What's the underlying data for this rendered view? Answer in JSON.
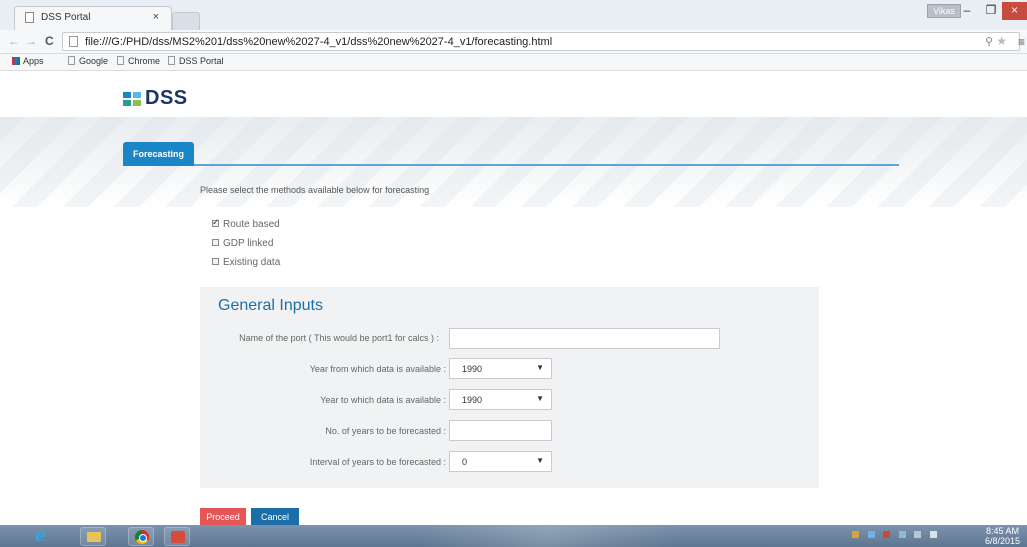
{
  "browser": {
    "tab_title": "DSS Portal",
    "tab_close": "×",
    "user_badge": "Vikas",
    "window_controls": {
      "minimize": "–",
      "maximize": "❐",
      "close": "×"
    },
    "url": "file:///G:/PHD/dss/MS2%201/dss%20new%2027-4_v1/dss%20new%2027-4_v1/forecasting.html",
    "bookmarks": [
      "Apps",
      "Google",
      "Chrome",
      "DSS Portal"
    ]
  },
  "site": {
    "logo_text": "DSS",
    "logo_colors": [
      "#1a86c8",
      "#5bb8e8",
      "#2a9d8f",
      "#8bc34a"
    ]
  },
  "tabs": [
    "Forecasting"
  ],
  "instruction": "Please select the methods available below for forecasting",
  "methods": [
    {
      "label": "Route based",
      "checked": true
    },
    {
      "label": "GDP linked",
      "checked": false
    },
    {
      "label": "Existing data",
      "checked": false
    }
  ],
  "general_inputs": {
    "title": "General Inputs",
    "port_name_label": "Name of the port ( This would be port1 for calcs ) :",
    "port_name_value": "",
    "year_from_label": "Year from which data is available :",
    "year_from_value": "1990",
    "year_to_label": "Year to which data is available :",
    "year_to_value": "1990",
    "years_forecast_label": "No. of years to be forecasted :",
    "years_forecast_value": "",
    "interval_label": "Interval of years to be forecasted :",
    "interval_value": "0"
  },
  "buttons": {
    "proceed": "Proceed",
    "cancel": "Cancel"
  },
  "taskbar": {
    "time": "8:45 AM",
    "date": "6/8/2015"
  },
  "colors": {
    "accent": "#1a86c8",
    "proceed": "#e55658",
    "cancel": "#1b6ea8",
    "title": "#1f6fa8"
  }
}
